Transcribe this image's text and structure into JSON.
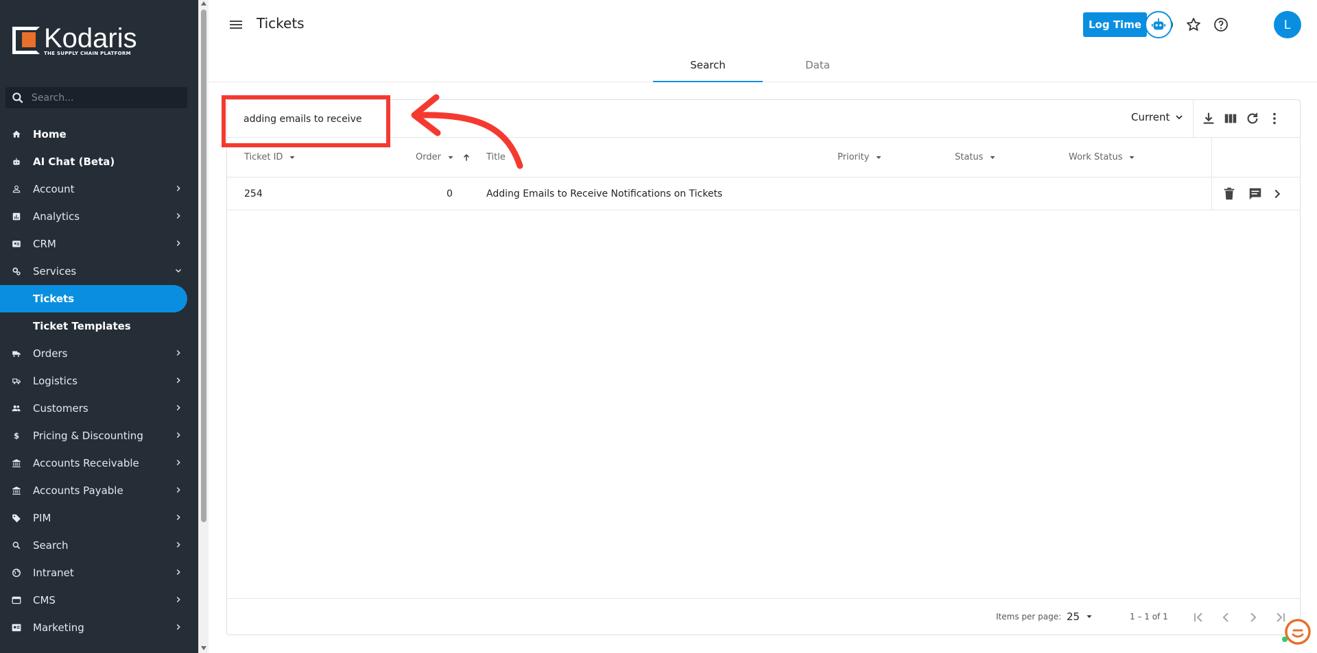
{
  "brand": {
    "name": "Kodaris",
    "tagline": "THE SUPPLY CHAIN PLATFORM"
  },
  "sidebar": {
    "search_placeholder": "Search...",
    "items": [
      {
        "label": "Home",
        "icon": "home-icon"
      },
      {
        "label": "AI Chat (Beta)",
        "icon": "robot-icon"
      },
      {
        "label": "Account",
        "icon": "person-icon"
      },
      {
        "label": "Analytics",
        "icon": "analytics-icon"
      },
      {
        "label": "CRM",
        "icon": "contact-card-icon"
      },
      {
        "label": "Services",
        "icon": "gears-icon"
      },
      {
        "label": "Tickets"
      },
      {
        "label": "Ticket Templates"
      },
      {
        "label": "Orders",
        "icon": "truck-icon"
      },
      {
        "label": "Logistics",
        "icon": "shipping-icon"
      },
      {
        "label": "Customers",
        "icon": "people-icon"
      },
      {
        "label": "Pricing & Discounting",
        "icon": "dollar-icon"
      },
      {
        "label": "Accounts Receivable",
        "icon": "bank-icon"
      },
      {
        "label": "Accounts Payable",
        "icon": "bank-icon"
      },
      {
        "label": "PIM",
        "icon": "tag-icon"
      },
      {
        "label": "Search",
        "icon": "search-icon"
      },
      {
        "label": "Intranet",
        "icon": "globe-icon"
      },
      {
        "label": "CMS",
        "icon": "window-icon"
      },
      {
        "label": "Marketing",
        "icon": "megaphone-icon"
      }
    ]
  },
  "header": {
    "title": "Tickets",
    "log_time_label": "Log Time",
    "avatar_initial": "L",
    "tabs": [
      {
        "label": "Search"
      },
      {
        "label": "Data"
      }
    ]
  },
  "table": {
    "search_value": "adding emails to receive",
    "view_selector": "Current",
    "columns": [
      {
        "label": "Ticket ID"
      },
      {
        "label": "Order"
      },
      {
        "label": "Title"
      },
      {
        "label": "Priority"
      },
      {
        "label": "Status"
      },
      {
        "label": "Work Status"
      }
    ],
    "rows": [
      {
        "ticket_id": "254",
        "order": "0",
        "title": "Adding Emails to Receive Notifications on Tickets",
        "priority": "",
        "status": "",
        "work_status": ""
      }
    ]
  },
  "paginator": {
    "items_per_page_label": "Items per page:",
    "page_size": "25",
    "range": "1 – 1 of 1"
  },
  "colors": {
    "accent": "#0a8fe0",
    "sidebar_bg": "#252d37",
    "annotation": "#f43a30",
    "brand_orange": "#e8702a"
  }
}
